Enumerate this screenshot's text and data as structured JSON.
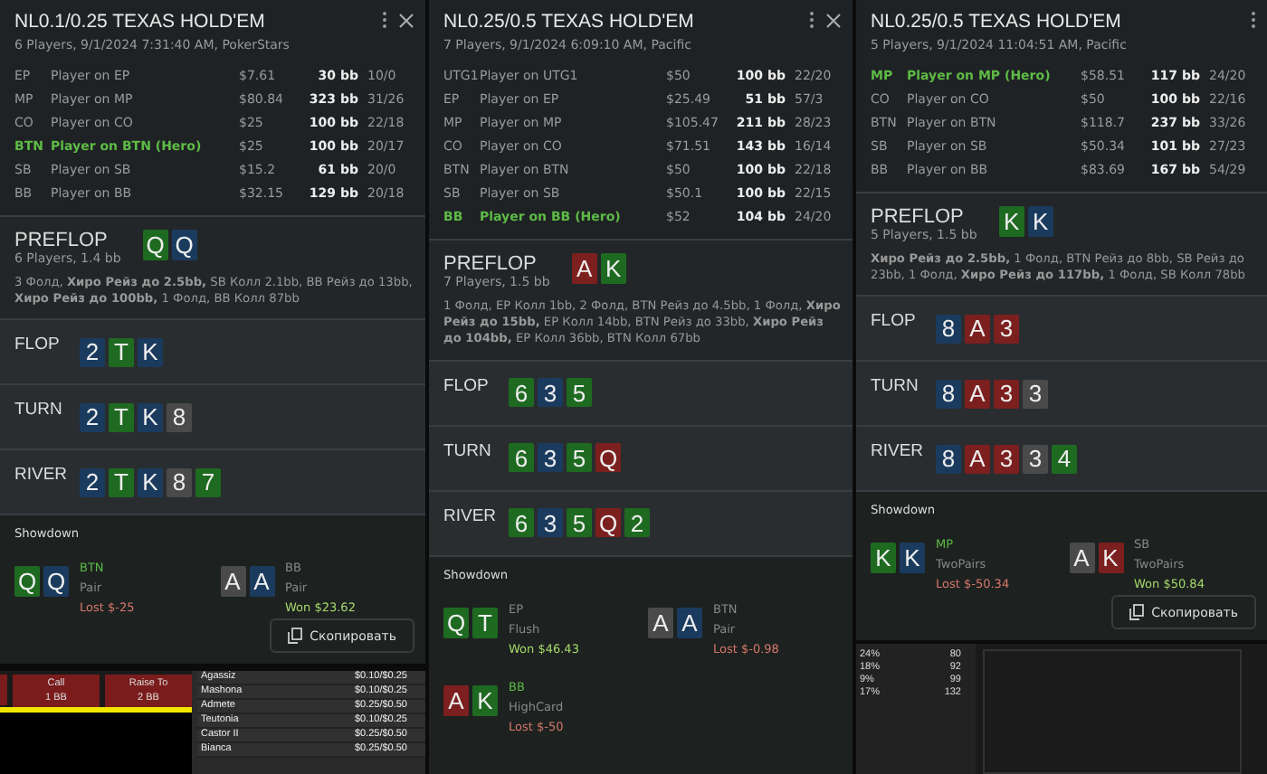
{
  "panels": [
    {
      "title": "NL0.1/0.25 TEXAS HOLD'EM",
      "subtitle": "6 Players, 9/1/2024 7:31:40 AM, PokerStars",
      "close_button": true,
      "players": [
        {
          "position": "EP",
          "name": "Player on EP",
          "stack": "$7.61",
          "bb": "30 bb",
          "stats": "10/0",
          "hero": false
        },
        {
          "position": "MP",
          "name": "Player on MP",
          "stack": "$80.84",
          "bb": "323 bb",
          "stats": "31/26",
          "hero": false
        },
        {
          "position": "CO",
          "name": "Player on CO",
          "stack": "$25",
          "bb": "100 bb",
          "stats": "22/18",
          "hero": false
        },
        {
          "position": "BTN",
          "name": "Player on BTN (Hero)",
          "stack": "$25",
          "bb": "100 bb",
          "stats": "20/17",
          "hero": true
        },
        {
          "position": "SB",
          "name": "Player on SB",
          "stack": "$15.2",
          "bb": "61 bb",
          "stats": "20/0",
          "hero": false
        },
        {
          "position": "BB",
          "name": "Player on BB",
          "stack": "$32.15",
          "bb": "129 bb",
          "stats": "20/18",
          "hero": false
        }
      ],
      "preflop": {
        "label": "PREFLOP",
        "subtitle": "6 Players, 1.4 bb",
        "cards": [
          {
            "rank": "Q",
            "color": "#1e6a21"
          },
          {
            "rank": "Q",
            "color": "#1b3b5e"
          }
        ],
        "actions": "3 Фолд, **Хиро Рейз до 2.5bb,** SB Колл 2.1bb, BB Рейз до 13bb, **Хиро Рейз до 100bb,** 1 Фолд, BB Колл 87bb"
      },
      "streets": [
        {
          "label": "FLOP",
          "cards": [
            {
              "rank": "2",
              "color": "#1b3b5e"
            },
            {
              "rank": "T",
              "color": "#1e6a21"
            },
            {
              "rank": "K",
              "color": "#1b3b5e"
            }
          ]
        },
        {
          "label": "TURN",
          "cards": [
            {
              "rank": "2",
              "color": "#1b3b5e"
            },
            {
              "rank": "T",
              "color": "#1e6a21"
            },
            {
              "rank": "K",
              "color": "#1b3b5e"
            },
            {
              "rank": "8",
              "color": "#4a4a4a"
            }
          ]
        },
        {
          "label": "RIVER",
          "cards": [
            {
              "rank": "2",
              "color": "#1b3b5e"
            },
            {
              "rank": "T",
              "color": "#1e6a21"
            },
            {
              "rank": "K",
              "color": "#1b3b5e"
            },
            {
              "rank": "8",
              "color": "#4a4a4a"
            },
            {
              "rank": "7",
              "color": "#1e6a21"
            }
          ]
        }
      ],
      "showdown": {
        "label": "Showdown",
        "results": [
          {
            "cards": [
              {
                "rank": "Q",
                "color": "#1e6a21"
              },
              {
                "rank": "Q",
                "color": "#1b3b5e"
              }
            ],
            "position": "BTN",
            "hero": true,
            "hand": "Pair",
            "result": "Lost $-25",
            "won": false
          },
          {
            "cards": [
              {
                "rank": "A",
                "color": "#4a4a4a"
              },
              {
                "rank": "A",
                "color": "#1b3b5e"
              }
            ],
            "position": "BB",
            "hero": false,
            "hand": "Pair",
            "result": "Won $23.62",
            "won": true
          }
        ]
      },
      "copy_button": "Скопировать"
    },
    {
      "title": "NL0.25/0.5 TEXAS HOLD'EM",
      "subtitle": "7 Players, 9/1/2024 6:09:10 AM, Pacific",
      "close_button": true,
      "players": [
        {
          "position": "UTG1",
          "name": "Player on UTG1",
          "stack": "$50",
          "bb": "100 bb",
          "stats": "22/20",
          "hero": false
        },
        {
          "position": "EP",
          "name": "Player on EP",
          "stack": "$25.49",
          "bb": "51 bb",
          "stats": "57/3",
          "hero": false
        },
        {
          "position": "MP",
          "name": "Player on MP",
          "stack": "$105.47",
          "bb": "211 bb",
          "stats": "28/23",
          "hero": false
        },
        {
          "position": "CO",
          "name": "Player on CO",
          "stack": "$71.51",
          "bb": "143 bb",
          "stats": "16/14",
          "hero": false
        },
        {
          "position": "BTN",
          "name": "Player on BTN",
          "stack": "$50",
          "bb": "100 bb",
          "stats": "22/18",
          "hero": false
        },
        {
          "position": "SB",
          "name": "Player on SB",
          "stack": "$50.1",
          "bb": "100 bb",
          "stats": "22/15",
          "hero": false
        },
        {
          "position": "BB",
          "name": "Player on BB (Hero)",
          "stack": "$52",
          "bb": "104 bb",
          "stats": "24/20",
          "hero": true
        }
      ],
      "preflop": {
        "label": "PREFLOP",
        "subtitle": "7 Players, 1.5 bb",
        "cards": [
          {
            "rank": "A",
            "color": "#7c1f1f"
          },
          {
            "rank": "K",
            "color": "#1e6a21"
          }
        ],
        "actions": "1 Фолд, EP Колл 1bb, 2 Фолд, BTN Рейз до 4.5bb, 1 Фолд, **Хиро Рейз до 15bb,** EP Колл 14bb, BTN Рейз до 33bb, **Хиро Рейз до 104bb,** EP Колл 36bb, BTN Колл 67bb"
      },
      "streets": [
        {
          "label": "FLOP",
          "cards": [
            {
              "rank": "6",
              "color": "#1e6a21"
            },
            {
              "rank": "3",
              "color": "#1b3b5e"
            },
            {
              "rank": "5",
              "color": "#1e6a21"
            }
          ]
        },
        {
          "label": "TURN",
          "cards": [
            {
              "rank": "6",
              "color": "#1e6a21"
            },
            {
              "rank": "3",
              "color": "#1b3b5e"
            },
            {
              "rank": "5",
              "color": "#1e6a21"
            },
            {
              "rank": "Q",
              "color": "#7c1f1f"
            }
          ]
        },
        {
          "label": "RIVER",
          "cards": [
            {
              "rank": "6",
              "color": "#1e6a21"
            },
            {
              "rank": "3",
              "color": "#1b3b5e"
            },
            {
              "rank": "5",
              "color": "#1e6a21"
            },
            {
              "rank": "Q",
              "color": "#7c1f1f"
            },
            {
              "rank": "2",
              "color": "#1e6a21"
            }
          ]
        }
      ],
      "showdown": {
        "label": "Showdown",
        "results": [
          {
            "cards": [
              {
                "rank": "Q",
                "color": "#1e6a21"
              },
              {
                "rank": "T",
                "color": "#1e6a21"
              }
            ],
            "position": "EP",
            "hero": false,
            "hand": "Flush",
            "result": "Won $46.43",
            "won": true
          },
          {
            "cards": [
              {
                "rank": "A",
                "color": "#4a4a4a"
              },
              {
                "rank": "A",
                "color": "#1b3b5e"
              }
            ],
            "position": "BTN",
            "hero": false,
            "hand": "Pair",
            "result": "Lost $-0.98",
            "won": false
          },
          {
            "cards": [
              {
                "rank": "A",
                "color": "#7c1f1f"
              },
              {
                "rank": "K",
                "color": "#1e6a21"
              }
            ],
            "position": "BB",
            "hero": true,
            "hand": "HighCard",
            "result": "Lost $-50",
            "won": false
          }
        ]
      }
    },
    {
      "title": "NL0.25/0.5 TEXAS HOLD'EM",
      "subtitle": "5 Players, 9/1/2024 11:04:51 AM, Pacific",
      "close_button": false,
      "players": [
        {
          "position": "MP",
          "name": "Player on MP (Hero)",
          "stack": "$58.51",
          "bb": "117 bb",
          "stats": "24/20",
          "hero": true
        },
        {
          "position": "CO",
          "name": "Player on CO",
          "stack": "$50",
          "bb": "100 bb",
          "stats": "22/16",
          "hero": false
        },
        {
          "position": "BTN",
          "name": "Player on BTN",
          "stack": "$118.7",
          "bb": "237 bb",
          "stats": "33/26",
          "hero": false
        },
        {
          "position": "SB",
          "name": "Player on SB",
          "stack": "$50.34",
          "bb": "101 bb",
          "stats": "27/23",
          "hero": false
        },
        {
          "position": "BB",
          "name": "Player on BB",
          "stack": "$83.69",
          "bb": "167 bb",
          "stats": "54/29",
          "hero": false
        }
      ],
      "preflop": {
        "label": "PREFLOP",
        "subtitle": "5 Players, 1.5 bb",
        "cards": [
          {
            "rank": "K",
            "color": "#1e6a21"
          },
          {
            "rank": "K",
            "color": "#1b3b5e"
          }
        ],
        "actions": "**Хиро Рейз до 2.5bb,** 1 Фолд, BTN Рейз до 8bb, SB Рейз до 23bb, 1 Фолд, **Хиро Рейз до 117bb,** 1 Фолд, SB Колл 78bb"
      },
      "streets": [
        {
          "label": "FLOP",
          "cards": [
            {
              "rank": "8",
              "color": "#1b3b5e"
            },
            {
              "rank": "A",
              "color": "#7c1f1f"
            },
            {
              "rank": "3",
              "color": "#7c1f1f"
            }
          ]
        },
        {
          "label": "TURN",
          "cards": [
            {
              "rank": "8",
              "color": "#1b3b5e"
            },
            {
              "rank": "A",
              "color": "#7c1f1f"
            },
            {
              "rank": "3",
              "color": "#7c1f1f"
            },
            {
              "rank": "3",
              "color": "#4a4a4a"
            }
          ]
        },
        {
          "label": "RIVER",
          "cards": [
            {
              "rank": "8",
              "color": "#1b3b5e"
            },
            {
              "rank": "A",
              "color": "#7c1f1f"
            },
            {
              "rank": "3",
              "color": "#7c1f1f"
            },
            {
              "rank": "3",
              "color": "#4a4a4a"
            },
            {
              "rank": "4",
              "color": "#1e6a21"
            }
          ]
        }
      ],
      "showdown": {
        "label": "Showdown",
        "results": [
          {
            "cards": [
              {
                "rank": "K",
                "color": "#1e6a21"
              },
              {
                "rank": "K",
                "color": "#1b3b5e"
              }
            ],
            "position": "MP",
            "hero": true,
            "hand": "TwoPairs",
            "result": "Lost $-50.34",
            "won": false
          },
          {
            "cards": [
              {
                "rank": "A",
                "color": "#4a4a4a"
              },
              {
                "rank": "K",
                "color": "#7c1f1f"
              }
            ],
            "position": "SB",
            "hero": false,
            "hand": "TwoPairs",
            "result": "Won $50.84",
            "won": true
          }
        ]
      },
      "copy_button": "Скопировать"
    }
  ],
  "poker_client": {
    "buttons": [
      {
        "label": "Call",
        "amount": "1 BB"
      },
      {
        "label": "Raise To",
        "amount": "2 BB"
      }
    ],
    "tables": [
      {
        "name": "Agassiz",
        "stakes": "$0.10/$0.25"
      },
      {
        "name": "Mashona",
        "stakes": "$0.10/$0.25"
      },
      {
        "name": "Admete",
        "stakes": "$0.25/$0.50"
      },
      {
        "name": "Teutonia",
        "stakes": "$0.10/$0.25"
      },
      {
        "name": "Castor II",
        "stakes": "$0.25/$0.50"
      },
      {
        "name": "Bianca",
        "stakes": "$0.25/$0.50"
      }
    ],
    "stats": [
      {
        "percent": "24%",
        "value": "80"
      },
      {
        "percent": "18%",
        "value": "92"
      },
      {
        "percent": "9%",
        "value": "99"
      },
      {
        "percent": "17%",
        "value": "132"
      }
    ]
  }
}
